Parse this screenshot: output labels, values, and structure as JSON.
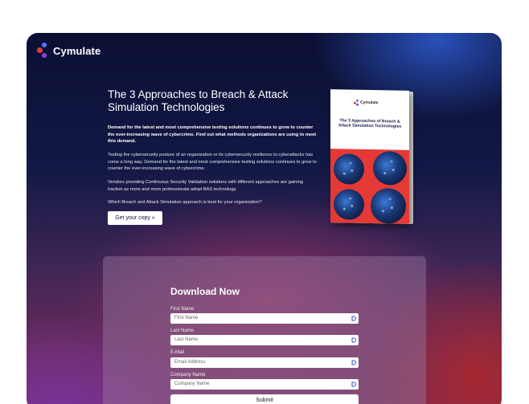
{
  "brand": {
    "name": "Cymulate"
  },
  "hero": {
    "title": "The 3 Approaches to Breach & Attack Simulation Technologies",
    "paragraph_bold": "Demand for the latest and most comprehensive testing solutions continues to grow to counter the ever-increasing wave of cybercrime. Find out what methods organizations are using to meet this demand.",
    "paragraph_2": "Testing the cybersecurity posture of an organization or its cybersecurity resilience to cyberattacks has come a long way. Demand for the latest and most comprehensive testing solutions continues to grow to counter the ever-increasing wave of cybercrime.",
    "paragraph_3": "Vendors providing Continuous Security Validation solutions with different approaches are gaining traction as more and more professionals adopt BAS technology.",
    "paragraph_4": "Which Breach and Attack Simulation approach is best for your organization?",
    "cta_label": "Get your copy »"
  },
  "book": {
    "brand": "Cymulate",
    "title": "The 3 Approaches of Breach & Attack Simulation Technologies"
  },
  "form": {
    "title": "Download Now",
    "fields": [
      {
        "label": "First Name",
        "placeholder": "First Name"
      },
      {
        "label": "Last Name",
        "placeholder": "Last Name"
      },
      {
        "label": "E-Mail",
        "placeholder": "Email Address"
      },
      {
        "label": "Company Name",
        "placeholder": "Company Name"
      }
    ],
    "submit_label": "Submit"
  },
  "colors": {
    "background_top": "#0b0f33",
    "accent_blue": "#2e5cd2",
    "accent_red": "#a8282e",
    "book_red": "#e53935"
  }
}
